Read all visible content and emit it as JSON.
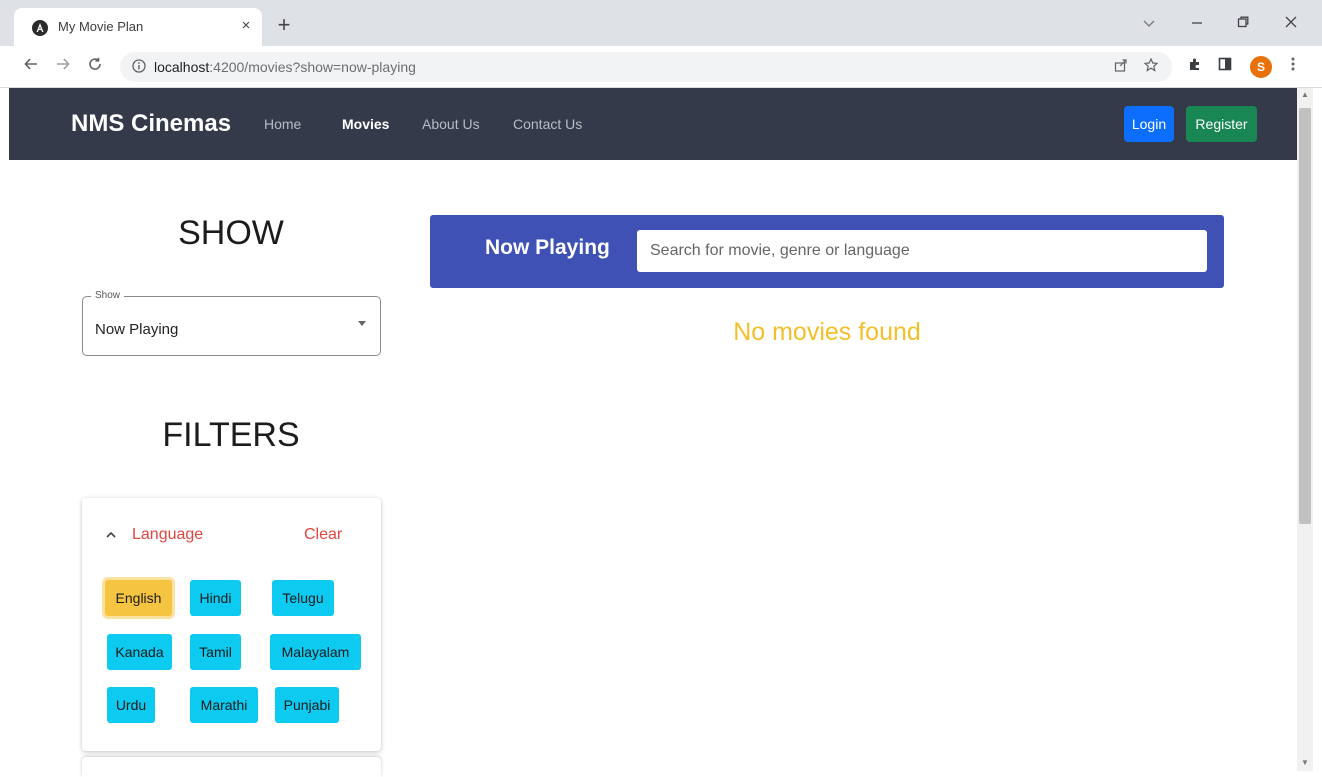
{
  "browser": {
    "tab_title": "My Movie Plan",
    "tab_close": "×",
    "new_tab": "+",
    "url_host": "localhost",
    "url_path": ":4200/movies?show=now-playing",
    "profile_initial": "S",
    "icons": [
      "angular-favicon-icon",
      "back-arrow-icon",
      "forward-arrow-icon",
      "reload-icon",
      "info-icon",
      "share-icon",
      "star-icon",
      "extensions-icon",
      "sidepanel-icon",
      "menu-dots-icon",
      "minimize-icon",
      "restore-icon",
      "close-window-icon",
      "tab-search-icon"
    ]
  },
  "navbar": {
    "brand": "NMS Cinemas",
    "links": [
      {
        "label": "Home",
        "active": false
      },
      {
        "label": "Movies",
        "active": true
      },
      {
        "label": "About Us",
        "active": false
      },
      {
        "label": "Contact Us",
        "active": false
      }
    ],
    "login_label": "Login",
    "register_label": "Register"
  },
  "sidebar": {
    "show_heading": "SHOW",
    "show_select": {
      "legend": "Show",
      "value": "Now Playing"
    },
    "filters_heading": "FILTERS",
    "language_filter": {
      "label": "Language",
      "clear_label": "Clear",
      "options": [
        "English",
        "Hindi",
        "Telugu",
        "Kanada",
        "Tamil",
        "Malayalam",
        "Urdu",
        "Marathi",
        "Punjabi"
      ],
      "selected": "English"
    }
  },
  "main": {
    "section_title": "Now Playing",
    "search_placeholder": "Search for movie, genre or language",
    "search_value": "",
    "empty_message": "No movies found"
  },
  "colors": {
    "navbar_bg": "#343a4a",
    "search_bar_bg": "#3f51b5",
    "login_btn": "#0d6efd",
    "register_btn": "#198754",
    "chip": "#0dcaf0",
    "chip_selected": "#f5c542",
    "filter_text": "#e0453f",
    "empty_text": "#f5bf2a"
  }
}
